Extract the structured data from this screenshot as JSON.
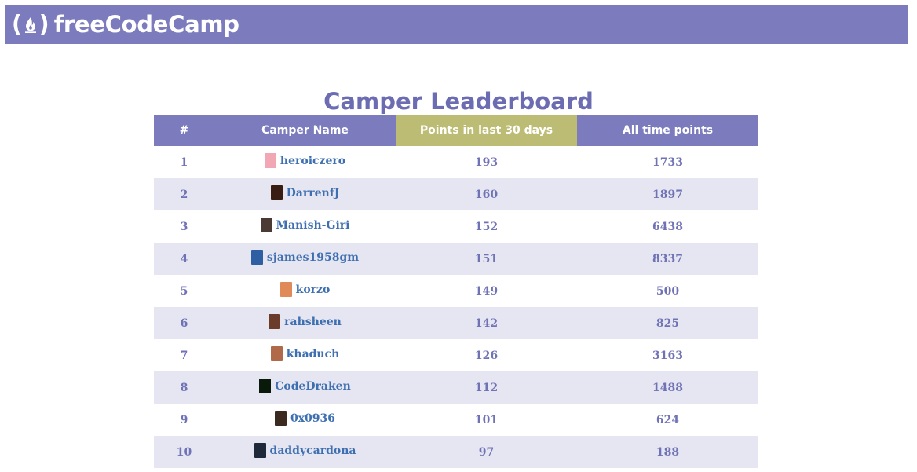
{
  "navbar": {
    "brand": "freeCodeCamp",
    "logo_icon": "campfire-icon",
    "background": "#7b7bbd"
  },
  "page": {
    "title": "Camper Leaderboard"
  },
  "table": {
    "headers": {
      "rank": "#",
      "name": "Camper Name",
      "recent": "Points in last 30 days",
      "alltime": "All time points"
    },
    "active_sort": "recent",
    "active_color": "#bdbc74",
    "rows": [
      {
        "rank": "1",
        "name": "heroiczero",
        "recent": "193",
        "alltime": "1733",
        "avatar": "#f2a7b5"
      },
      {
        "rank": "2",
        "name": "DarrenfJ",
        "recent": "160",
        "alltime": "1897",
        "avatar": "#3a1d12"
      },
      {
        "rank": "3",
        "name": "Manish-Giri",
        "recent": "152",
        "alltime": "6438",
        "avatar": "#4b3a33"
      },
      {
        "rank": "4",
        "name": "sjames1958gm",
        "recent": "151",
        "alltime": "8337",
        "avatar": "#2e5fa3"
      },
      {
        "rank": "5",
        "name": "korzo",
        "recent": "149",
        "alltime": "500",
        "avatar": "#e08a5a"
      },
      {
        "rank": "6",
        "name": "rahsheen",
        "recent": "142",
        "alltime": "825",
        "avatar": "#6b3c2a"
      },
      {
        "rank": "7",
        "name": "khaduch",
        "recent": "126",
        "alltime": "3163",
        "avatar": "#b06a4a"
      },
      {
        "rank": "8",
        "name": "CodeDraken",
        "recent": "112",
        "alltime": "1488",
        "avatar": "#0a1a0a"
      },
      {
        "rank": "9",
        "name": "0x0936",
        "recent": "101",
        "alltime": "624",
        "avatar": "#3a2a20"
      },
      {
        "rank": "10",
        "name": "daddycardona",
        "recent": "97",
        "alltime": "188",
        "avatar": "#1e2a3a"
      }
    ]
  }
}
